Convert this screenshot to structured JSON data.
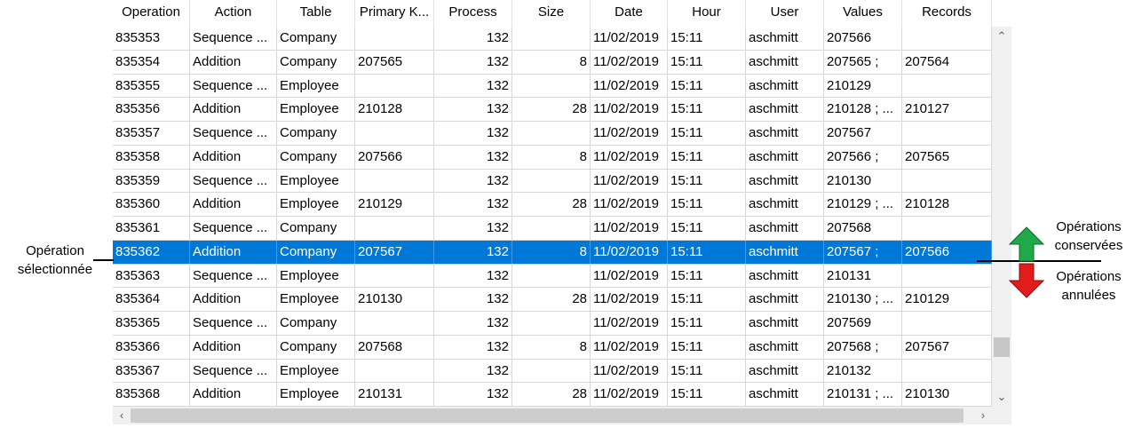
{
  "columns": [
    {
      "key": "operation",
      "label": "Operation"
    },
    {
      "key": "action",
      "label": "Action"
    },
    {
      "key": "table",
      "label": "Table"
    },
    {
      "key": "primary_key",
      "label": "Primary K..."
    },
    {
      "key": "process",
      "label": "Process"
    },
    {
      "key": "size",
      "label": "Size"
    },
    {
      "key": "date",
      "label": "Date"
    },
    {
      "key": "hour",
      "label": "Hour"
    },
    {
      "key": "user",
      "label": "User"
    },
    {
      "key": "values",
      "label": "Values"
    },
    {
      "key": "records",
      "label": "Records"
    }
  ],
  "rows": [
    {
      "operation": "835353",
      "action": "Sequence ...",
      "table": "Company",
      "primary_key": "",
      "process": "132",
      "size": "",
      "date": "11/02/2019",
      "hour": "15:11",
      "user": "aschmitt",
      "values": "207566",
      "records": ""
    },
    {
      "operation": "835354",
      "action": "Addition",
      "table": "Company",
      "primary_key": "207565",
      "process": "132",
      "size": "8",
      "date": "11/02/2019",
      "hour": "15:11",
      "user": "aschmitt",
      "values": "207565 ;",
      "records": "207564"
    },
    {
      "operation": "835355",
      "action": "Sequence ...",
      "table": "Employee",
      "primary_key": "",
      "process": "132",
      "size": "",
      "date": "11/02/2019",
      "hour": "15:11",
      "user": "aschmitt",
      "values": "210129",
      "records": ""
    },
    {
      "operation": "835356",
      "action": "Addition",
      "table": "Employee",
      "primary_key": "210128",
      "process": "132",
      "size": "28",
      "date": "11/02/2019",
      "hour": "15:11",
      "user": "aschmitt",
      "values": "210128 ; ...",
      "records": "210127"
    },
    {
      "operation": "835357",
      "action": "Sequence ...",
      "table": "Company",
      "primary_key": "",
      "process": "132",
      "size": "",
      "date": "11/02/2019",
      "hour": "15:11",
      "user": "aschmitt",
      "values": "207567",
      "records": ""
    },
    {
      "operation": "835358",
      "action": "Addition",
      "table": "Company",
      "primary_key": "207566",
      "process": "132",
      "size": "8",
      "date": "11/02/2019",
      "hour": "15:11",
      "user": "aschmitt",
      "values": "207566 ;",
      "records": "207565"
    },
    {
      "operation": "835359",
      "action": "Sequence ...",
      "table": "Employee",
      "primary_key": "",
      "process": "132",
      "size": "",
      "date": "11/02/2019",
      "hour": "15:11",
      "user": "aschmitt",
      "values": "210130",
      "records": ""
    },
    {
      "operation": "835360",
      "action": "Addition",
      "table": "Employee",
      "primary_key": "210129",
      "process": "132",
      "size": "28",
      "date": "11/02/2019",
      "hour": "15:11",
      "user": "aschmitt",
      "values": "210129 ; ...",
      "records": "210128"
    },
    {
      "operation": "835361",
      "action": "Sequence ...",
      "table": "Company",
      "primary_key": "",
      "process": "132",
      "size": "",
      "date": "11/02/2019",
      "hour": "15:11",
      "user": "aschmitt",
      "values": "207568",
      "records": ""
    },
    {
      "operation": "835362",
      "action": "Addition",
      "table": "Company",
      "primary_key": "207567",
      "process": "132",
      "size": "8",
      "date": "11/02/2019",
      "hour": "15:11",
      "user": "aschmitt",
      "values": "207567 ;",
      "records": "207566",
      "selected": true
    },
    {
      "operation": "835363",
      "action": "Sequence ...",
      "table": "Employee",
      "primary_key": "",
      "process": "132",
      "size": "",
      "date": "11/02/2019",
      "hour": "15:11",
      "user": "aschmitt",
      "values": "210131",
      "records": ""
    },
    {
      "operation": "835364",
      "action": "Addition",
      "table": "Employee",
      "primary_key": "210130",
      "process": "132",
      "size": "28",
      "date": "11/02/2019",
      "hour": "15:11",
      "user": "aschmitt",
      "values": "210130 ; ...",
      "records": "210129"
    },
    {
      "operation": "835365",
      "action": "Sequence ...",
      "table": "Company",
      "primary_key": "",
      "process": "132",
      "size": "",
      "date": "11/02/2019",
      "hour": "15:11",
      "user": "aschmitt",
      "values": "207569",
      "records": ""
    },
    {
      "operation": "835366",
      "action": "Addition",
      "table": "Company",
      "primary_key": "207568",
      "process": "132",
      "size": "8",
      "date": "11/02/2019",
      "hour": "15:11",
      "user": "aschmitt",
      "values": "207568 ;",
      "records": "207567"
    },
    {
      "operation": "835367",
      "action": "Sequence ...",
      "table": "Employee",
      "primary_key": "",
      "process": "132",
      "size": "",
      "date": "11/02/2019",
      "hour": "15:11",
      "user": "aschmitt",
      "values": "210132",
      "records": ""
    },
    {
      "operation": "835368",
      "action": "Addition",
      "table": "Employee",
      "primary_key": "210131",
      "process": "132",
      "size": "28",
      "date": "11/02/2019",
      "hour": "15:11",
      "user": "aschmitt",
      "values": "210131 ; ...",
      "records": "210130"
    }
  ],
  "annotations": {
    "selected_line1": "Opération",
    "selected_line2": "sélectionnée",
    "kept_line1": "Opérations",
    "kept_line2": "conservées",
    "cancelled_line1": "Opérations",
    "cancelled_line2": "annulées"
  },
  "scrollbar": {
    "up_icon": "chevron-up-icon",
    "down_icon": "chevron-down-icon",
    "left_icon": "chevron-left-icon",
    "right_icon": "chevron-right-icon"
  },
  "colors": {
    "selection": "#0078d7",
    "arrow_up": "#1fa94b",
    "arrow_down": "#e21b1b"
  }
}
